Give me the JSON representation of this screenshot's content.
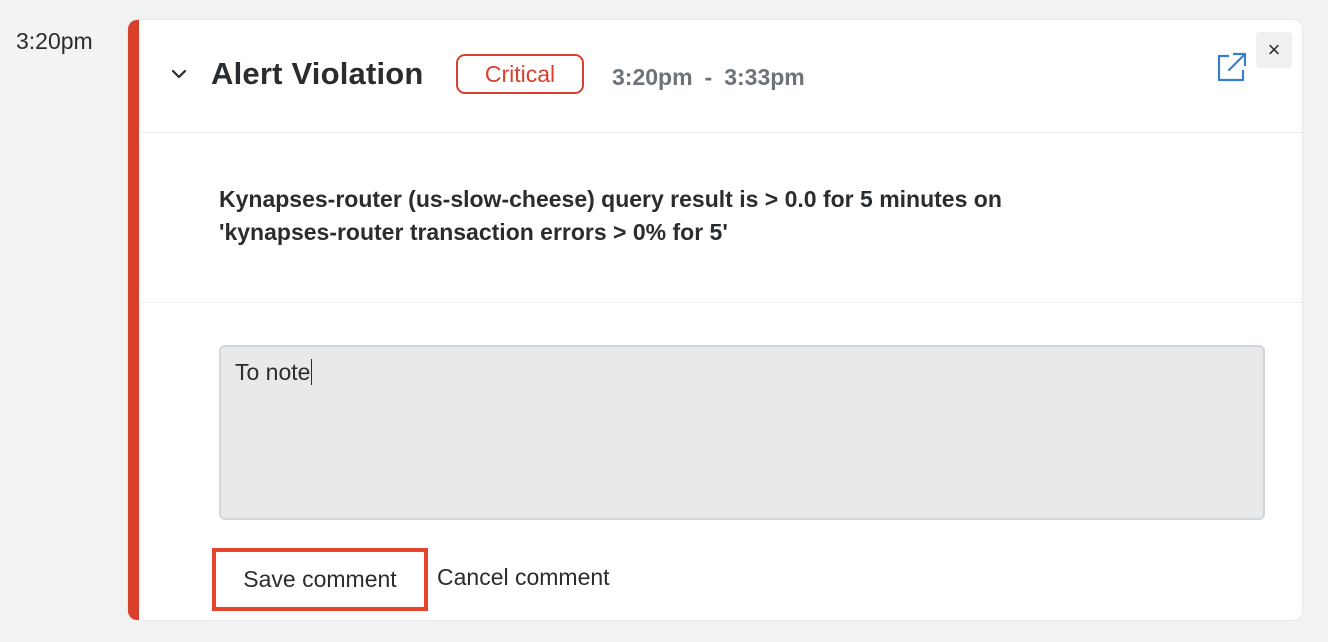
{
  "timeline": {
    "time": "3:20pm"
  },
  "alert": {
    "title": "Alert Violation",
    "severity": "Critical",
    "start_time": "3:20pm",
    "separator": "-",
    "end_time": "3:33pm",
    "message_line1": "Kynapses-router (us-slow-cheese) query result is > 0.0 for 5 minutes on",
    "message_line2": "'kynapses-router transaction errors > 0% for 5'",
    "accent_color": "#d8402c",
    "close_symbol": "×"
  },
  "icons": {
    "collapse": "chevron-down-icon",
    "open_external": "external-link-icon",
    "close": "close-icon"
  },
  "comment": {
    "value": "To note",
    "save_label": "Save comment",
    "cancel_label": "Cancel comment"
  }
}
